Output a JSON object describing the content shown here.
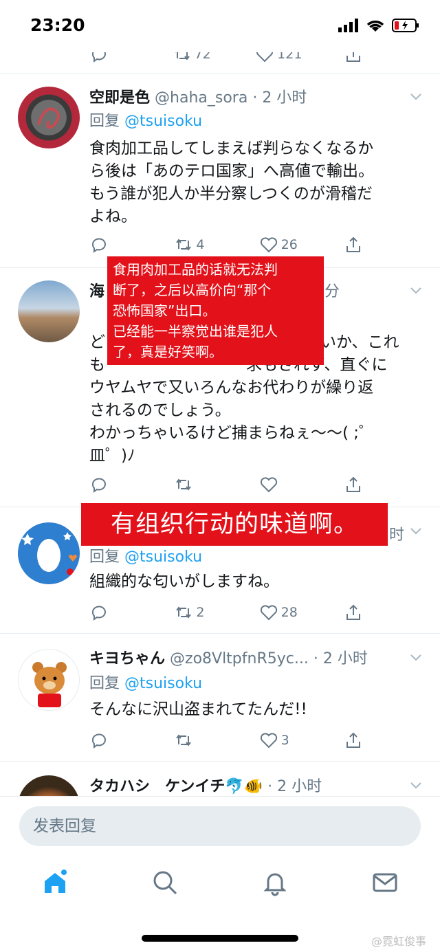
{
  "status_bar": {
    "time": "23:20"
  },
  "overlays": {
    "small_lines": [
      "食用肉加工品的话就无法判",
      "断了，之后以高价向“那个",
      "恐怖国家”出口。",
      "已经能一半察觉出谁是犯人",
      "了，真是好笑啊。"
    ],
    "big": "有组织行动的味道啊。"
  },
  "prev_tweet": {
    "retweets": "72",
    "likes": "121"
  },
  "tweets": [
    {
      "name": "空即是色",
      "handle": "@haha_sora",
      "time": "· 2 小时",
      "reply_label": "回复",
      "reply_to": "@tsuisoku",
      "lines": [
        "食肉加工品してしまえば判らなくなるか",
        "ら後は「あのテロ国家」へ高値で輸出。",
        "もう誰が犯人か半分察しつくのが滑稽だ",
        "よね。"
      ],
      "retweets": "4",
      "likes": "26"
    },
    {
      "name": "海",
      "time_tail": "分",
      "lines": [
        "ど",
        "いか、これ",
        "も",
        "求もされず、直ぐに",
        "ウヤムヤで又いろんなお代わりが繰り返",
        "されるのでしょう。",
        "わかっちゃいるけど捕まらねぇ〜〜( ;゜",
        "皿゜)ﾉ"
      ],
      "retweets": "",
      "likes": ""
    },
    {
      "time_tail": "时",
      "reply_label": "回复",
      "reply_to": "@tsuisoku",
      "lines": [
        "組織的な匂いがしますね。"
      ],
      "retweets": "2",
      "likes": "28"
    },
    {
      "name": "キヨちゃん",
      "handle": "@zo8VltpfnR5yc...",
      "time": "· 2 小时",
      "reply_label": "回复",
      "reply_to": "@tsuisoku",
      "lines": [
        "そんなに沢山盗まれてたんだ!!"
      ],
      "retweets": "",
      "likes": "3"
    },
    {
      "name": "タカハシ　ケンイチ🐬🐠",
      "time": "· 2 小时"
    }
  ],
  "reply_bar": {
    "placeholder": "发表回复"
  },
  "watermark": "@霓虹俊事"
}
